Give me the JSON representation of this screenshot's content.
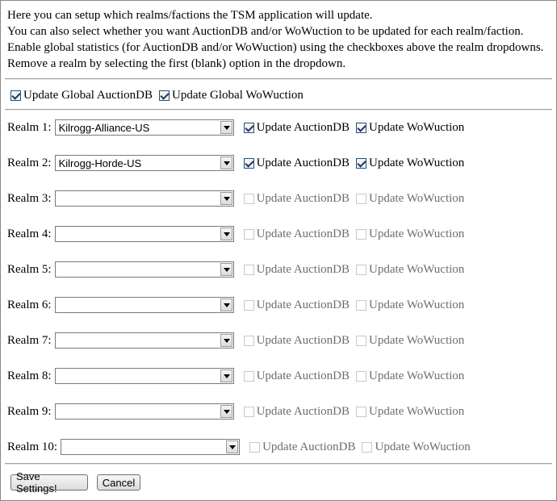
{
  "intro": [
    "Here you can setup which realms/factions the TSM application will update.",
    "You can also select whether you want AuctionDB and/or WoWuction to be updated for each realm/faction.",
    "Enable global statistics (for AuctionDB and/or WoWuction) using the checkboxes above the realm dropdowns.",
    "Remove a realm by selecting the first (blank) option in the dropdown."
  ],
  "global": {
    "auctiondb_label": "Update Global AuctionDB",
    "wowuction_label": "Update Global WoWuction",
    "auctiondb_checked": true,
    "wowuction_checked": true
  },
  "realms": [
    {
      "label": "Realm 1:",
      "value": "Kilrogg-Alliance-US",
      "auctiondb": "Update AuctionDB",
      "wowuction": "Update WoWuction",
      "adb_checked": true,
      "wow_checked": true
    },
    {
      "label": "Realm 2:",
      "value": "Kilrogg-Horde-US",
      "auctiondb": "Update AuctionDB",
      "wowuction": "Update WoWuction",
      "adb_checked": true,
      "wow_checked": true
    },
    {
      "label": "Realm 3:",
      "value": "",
      "auctiondb": "Update AuctionDB",
      "wowuction": "Update WoWuction",
      "adb_checked": false,
      "wow_checked": false
    },
    {
      "label": "Realm 4:",
      "value": "",
      "auctiondb": "Update AuctionDB",
      "wowuction": "Update WoWuction",
      "adb_checked": false,
      "wow_checked": false
    },
    {
      "label": "Realm 5:",
      "value": "",
      "auctiondb": "Update AuctionDB",
      "wowuction": "Update WoWuction",
      "adb_checked": false,
      "wow_checked": false
    },
    {
      "label": "Realm 6:",
      "value": "",
      "auctiondb": "Update AuctionDB",
      "wowuction": "Update WoWuction",
      "adb_checked": false,
      "wow_checked": false
    },
    {
      "label": "Realm 7:",
      "value": "",
      "auctiondb": "Update AuctionDB",
      "wowuction": "Update WoWuction",
      "adb_checked": false,
      "wow_checked": false
    },
    {
      "label": "Realm 8:",
      "value": "",
      "auctiondb": "Update AuctionDB",
      "wowuction": "Update WoWuction",
      "adb_checked": false,
      "wow_checked": false
    },
    {
      "label": "Realm 9:",
      "value": "",
      "auctiondb": "Update AuctionDB",
      "wowuction": "Update WoWuction",
      "adb_checked": false,
      "wow_checked": false
    },
    {
      "label": "Realm 10:",
      "value": "",
      "auctiondb": "Update AuctionDB",
      "wowuction": "Update WoWuction",
      "adb_checked": false,
      "wow_checked": false
    }
  ],
  "buttons": {
    "save": "Save Settings!",
    "cancel": "Cancel"
  }
}
